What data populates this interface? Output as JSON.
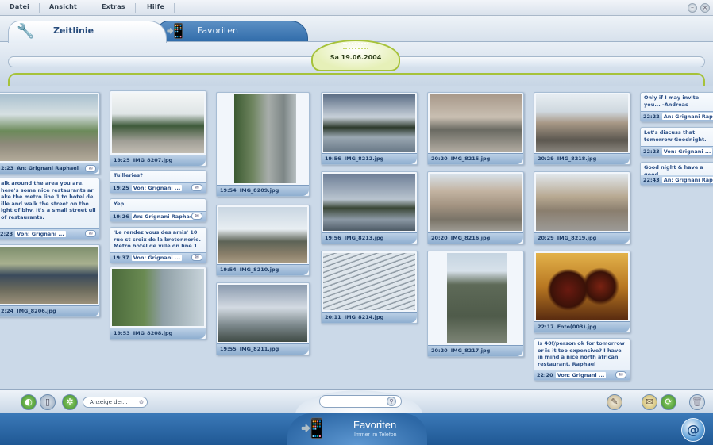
{
  "menu": [
    "Datei",
    "Ansicht",
    "Extras",
    "Hilfe"
  ],
  "tabs": {
    "active": "Zeitlinie",
    "inactive": "Favoriten"
  },
  "timeline": {
    "date": "Sa 19.06.2004"
  },
  "photos": [
    {
      "time": "2:23",
      "sender": "An: Grignani Raphael",
      "kind": "message"
    },
    {
      "time": "2:24",
      "name": "IMG_8206.jpg"
    },
    {
      "time": "19:25",
      "name": "IMG_8207.jpg"
    },
    {
      "time": "19:53",
      "name": "IMG_8208.jpg"
    },
    {
      "time": "19:54",
      "name": "IMG_8209.jpg"
    },
    {
      "time": "19:54",
      "name": "IMG_8210.jpg"
    },
    {
      "time": "19:55",
      "name": "IMG_8211.jpg"
    },
    {
      "time": "19:56",
      "name": "IMG_8212.jpg"
    },
    {
      "time": "19:56",
      "name": "IMG_8213.jpg"
    },
    {
      "time": "20:11",
      "name": "IMG_8214.jpg"
    },
    {
      "time": "20:20",
      "name": "IMG_8215.jpg"
    },
    {
      "time": "20:20",
      "name": "IMG_8216.jpg"
    },
    {
      "time": "20:20",
      "name": "IMG_8217.jpg"
    },
    {
      "time": "20:29",
      "name": "IMG_8218.jpg"
    },
    {
      "time": "20:29",
      "name": "IMG_8219.jpg"
    },
    {
      "time": "22:17",
      "name": "Foto(003).jpg"
    }
  ],
  "notes": [
    {
      "text": "alk around the area you are. here's some nice restaurants ar ake the metro line 1 to hotel de ille and walk the street on the ight of bhv. It's a small street ull of restaurants.",
      "time": "2:23",
      "label": "Von: Grignani ..."
    },
    {
      "text": "Tuilleries?",
      "time": "19:25",
      "label": "Von: Grignani ..."
    },
    {
      "text": "Yep",
      "time": "19:26",
      "label": "An: Grignani Raphael"
    },
    {
      "text": "'Le rendez vous des amis' 10 rue st croix de la bretonnerie. Metro hotel de ville on line 1",
      "time": "19:37",
      "label": "Von: Grignani ..."
    },
    {
      "text": "Is 40f/person ok for tomorrow or is it too expensive? I have in mind a nice north african restaurant. Raphael",
      "time": "22:20",
      "label": "Von: Grignani ..."
    },
    {
      "text": "Only if I may invite you... -Andreas",
      "time": "22:22",
      "label": "An: Grignani Raphael"
    },
    {
      "text": "Let's discuss that tomorrow Goodnight.",
      "time": "22:23",
      "label": "Von: Grignani ..."
    },
    {
      "text": "Good night & have a good",
      "time": "22:43",
      "label": "An: Grignani Raphael"
    }
  ],
  "toolbar": {
    "filter_label": "Anzeige der..."
  },
  "footer": {
    "title": "Favoriten",
    "subtitle": "Immer im Telefon"
  }
}
